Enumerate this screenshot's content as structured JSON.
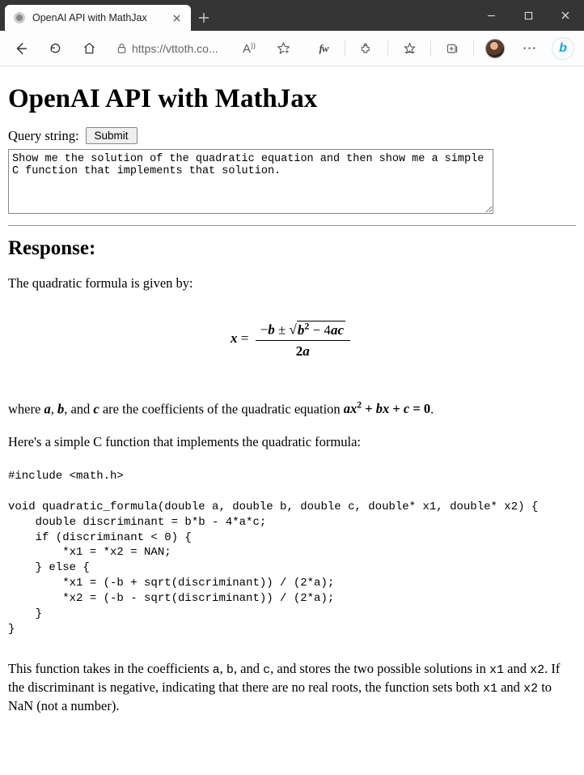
{
  "browser": {
    "tab_title": "OpenAI API with MathJax",
    "url": "https://vttoth.co..."
  },
  "page": {
    "title": "OpenAI API with MathJax",
    "query_label": "Query string:",
    "submit_label": "Submit",
    "query_value": "Show me the solution of the quadratic equation and then show me a simple C function that implements that solution.",
    "response_heading": "Response:",
    "p1": "The quadratic formula is given by:",
    "formula": {
      "lhs_var": "x",
      "eq": " = ",
      "num_prefix": "−",
      "num_b": "b",
      "num_pm": " ± ",
      "num_sqrt_sym": "√",
      "num_sqrt_inner_b": "b",
      "num_sqrt_inner_exp": "2",
      "num_sqrt_inner_minus": " − 4",
      "num_sqrt_inner_a": "a",
      "num_sqrt_inner_c": "c",
      "den_2": "2",
      "den_a": "a"
    },
    "p2_parts": {
      "t1": "where ",
      "a": "a",
      "c1": ", ",
      "b": "b",
      "c2": ", and ",
      "c": "c",
      "t2": " are the coefficients of the quadratic equation ",
      "eq_a": "a",
      "eq_x": "x",
      "eq_exp": "2",
      "eq_plus1": " + ",
      "eq_b": "b",
      "eq_x2": "x",
      "eq_plus2": " + ",
      "eq_c": "c",
      "eq_eq0": " = 0",
      "period": "."
    },
    "p3": "Here's a simple C function that implements the quadratic formula:",
    "code": "#include <math.h>\n\nvoid quadratic_formula(double a, double b, double c, double* x1, double* x2) {\n    double discriminant = b*b - 4*a*c;\n    if (discriminant < 0) {\n        *x1 = *x2 = NAN;\n    } else {\n        *x1 = (-b + sqrt(discriminant)) / (2*a);\n        *x2 = (-b - sqrt(discriminant)) / (2*a);\n    }\n}",
    "p4_parts": {
      "t1": "This function takes in the coefficients ",
      "a": "a",
      "c1": ", ",
      "b": "b",
      "c2": ", and ",
      "c": "c",
      "t2": ", and stores the two possible solutions in ",
      "x1": "x1",
      "c3": " and ",
      "x2": "x2",
      "t3": ". If the discriminant is negative, indicating that there are no real roots, the function sets both ",
      "x1b": "x1",
      "c4": " and ",
      "x2b": "x2",
      "t4": " to NaN (not a number)."
    }
  }
}
